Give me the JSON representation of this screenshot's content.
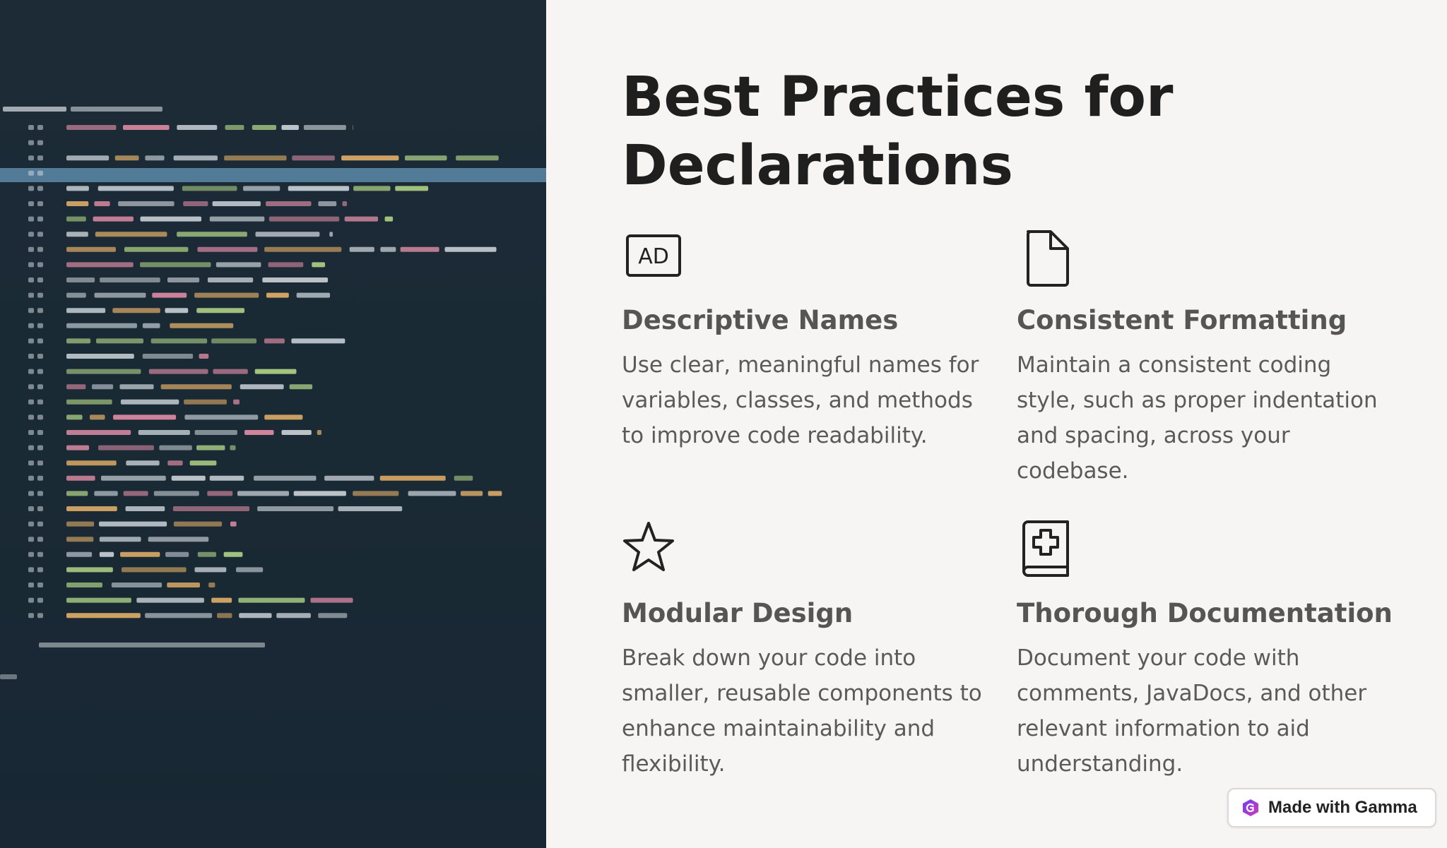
{
  "slide": {
    "title_line1": "Best Practices for",
    "title_line2": "Declarations"
  },
  "cards": [
    {
      "icon": "ad-icon",
      "heading": "Descriptive Names",
      "body": "Use clear, meaningful names for variables, classes, and methods to improve code readability."
    },
    {
      "icon": "document-icon",
      "heading": "Consistent Formatting",
      "body": "Maintain a consistent coding style, such as proper indentation and spacing, across your codebase."
    },
    {
      "icon": "star-icon",
      "heading": "Modular Design",
      "body": "Break down your code into smaller, reusable components to enhance maintainability and flexibility."
    },
    {
      "icon": "book-plus-icon",
      "heading": "Thorough Documentation",
      "body": "Document your code with comments, JavaDocs, and other relevant information to aid understanding."
    }
  ],
  "badge": {
    "label": "Made with Gamma"
  },
  "colors": {
    "code_background": "#1b2a35",
    "highlight_line": "#5b8aa8",
    "slide_background": "#f6f5f4",
    "title": "#1f1f1f",
    "heading": "#555555",
    "body": "#5a5a5a",
    "code_pink": "#e58fa8",
    "code_green": "#b6d98a",
    "code_orange": "#e7b26a",
    "code_gray": "#cfd6dc"
  }
}
